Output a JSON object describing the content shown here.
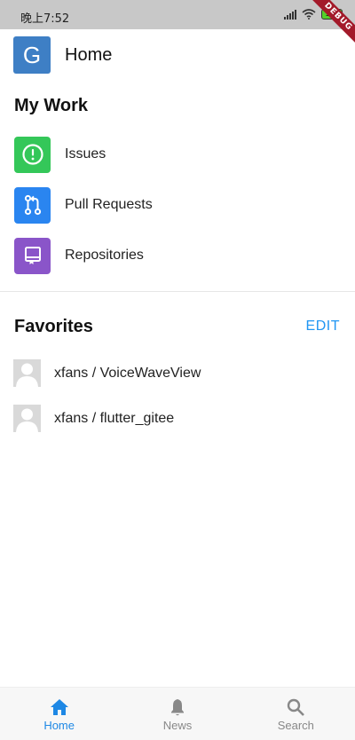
{
  "status_bar": {
    "time": "晚上7:52",
    "battery": "100",
    "debug_label": "DEBUG"
  },
  "header": {
    "avatar_letter": "G",
    "title": "Home"
  },
  "my_work": {
    "title": "My Work",
    "items": [
      {
        "label": "Issues",
        "icon": "issue-icon",
        "color": "#34c759"
      },
      {
        "label": "Pull Requests",
        "icon": "pull-request-icon",
        "color": "#2a85f0"
      },
      {
        "label": "Repositories",
        "icon": "repository-icon",
        "color": "#8a55c9"
      }
    ]
  },
  "favorites": {
    "title": "Favorites",
    "edit_label": "EDIT",
    "items": [
      {
        "label": "xfans / VoiceWaveView"
      },
      {
        "label": "xfans / flutter_gitee"
      }
    ]
  },
  "bottom_nav": {
    "items": [
      {
        "label": "Home",
        "icon": "home-icon",
        "active": true
      },
      {
        "label": "News",
        "icon": "bell-icon",
        "active": false
      },
      {
        "label": "Search",
        "icon": "search-icon",
        "active": false
      }
    ],
    "active_color": "#1e88e5",
    "inactive_color": "#888888"
  }
}
